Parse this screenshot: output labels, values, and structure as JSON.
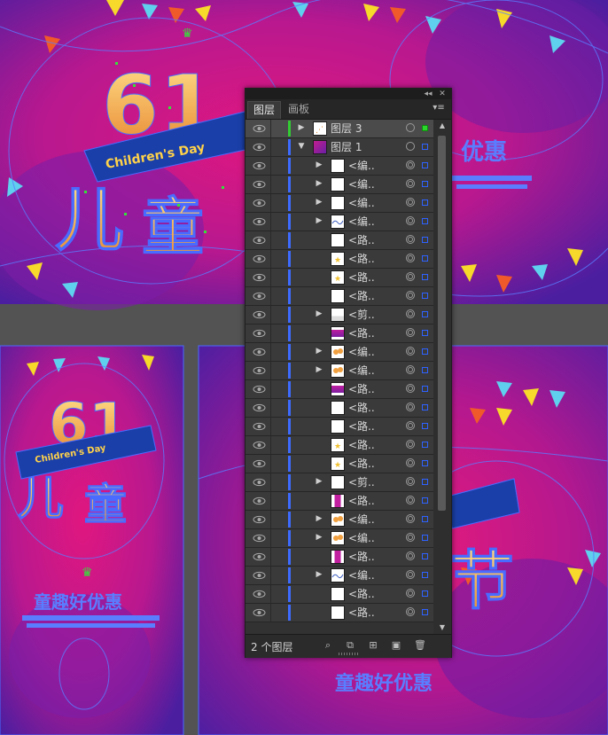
{
  "colors": {
    "canvas_bg": "#535353",
    "artwork_magenta": "#d1158f",
    "artwork_purple": "#5b1fa8",
    "selection_blue": "#4a6bff",
    "path_green": "#35e23a",
    "title_text_orange": "#f2a33a",
    "panel_bg": "#323232",
    "row_bg": "#3a3a3a"
  },
  "artboards": {
    "top_title_text": "6·1 儿童节",
    "ribbon_text": "Children's Day",
    "bottom_left_title_text": "6·1 儿童节",
    "bottom_left_ribbon_text": "Children's Day",
    "promo_text_top_right": "优惠",
    "promo_text_bottom_left": "童趣好优惠",
    "promo_text_bottom_right": "童趣好优惠"
  },
  "panel": {
    "tabs": [
      {
        "label": "图层",
        "active": true
      },
      {
        "label": "画板",
        "active": false
      }
    ],
    "collapse_icon": "double-arrow-left-icon",
    "close_icon": "close-icon",
    "menu_icon": "panel-menu-icon",
    "rows": [
      {
        "name": "图层 3",
        "level": 0,
        "expanded": false,
        "has_arrow": true,
        "thumb": "layer3-thumb",
        "bar_color": "#33cc33",
        "sel": "green",
        "selected": true
      },
      {
        "name": "图层 1",
        "level": 0,
        "expanded": true,
        "has_arrow": true,
        "thumb": "layer1-thumb",
        "bar_color": "#3d6bff",
        "sel": "blue",
        "selected": false
      },
      {
        "name": "<编..",
        "level": 1,
        "has_arrow": true,
        "thumb": "white",
        "sel": "blue"
      },
      {
        "name": "<编..",
        "level": 1,
        "has_arrow": true,
        "thumb": "white",
        "sel": "blue"
      },
      {
        "name": "<编..",
        "level": 1,
        "has_arrow": true,
        "thumb": "white",
        "sel": "blue"
      },
      {
        "name": "<编..",
        "level": 1,
        "has_arrow": true,
        "thumb": "squiggle",
        "sel": "blue"
      },
      {
        "name": "<路..",
        "level": 1,
        "has_arrow": false,
        "thumb": "white",
        "sel": "blue"
      },
      {
        "name": "<路..",
        "level": 1,
        "has_arrow": false,
        "thumb": "star",
        "sel": "blue"
      },
      {
        "name": "<路..",
        "level": 1,
        "has_arrow": false,
        "thumb": "star",
        "sel": "blue"
      },
      {
        "name": "<路..",
        "level": 1,
        "has_arrow": false,
        "thumb": "white",
        "sel": "blue"
      },
      {
        "name": "<剪..",
        "level": 1,
        "has_arrow": true,
        "thumb": "clip",
        "sel": "blue"
      },
      {
        "name": "<路..",
        "level": 1,
        "has_arrow": false,
        "thumb": "magenta",
        "sel": "blue"
      },
      {
        "name": "<编..",
        "level": 1,
        "has_arrow": true,
        "thumb": "orange",
        "sel": "blue"
      },
      {
        "name": "<编..",
        "level": 1,
        "has_arrow": true,
        "thumb": "orange",
        "sel": "blue"
      },
      {
        "name": "<路..",
        "level": 1,
        "has_arrow": false,
        "thumb": "magenta",
        "sel": "blue"
      },
      {
        "name": "<路..",
        "level": 1,
        "has_arrow": false,
        "thumb": "white",
        "sel": "blue"
      },
      {
        "name": "<路..",
        "level": 1,
        "has_arrow": false,
        "thumb": "white",
        "sel": "blue"
      },
      {
        "name": "<路..",
        "level": 1,
        "has_arrow": false,
        "thumb": "star",
        "sel": "blue"
      },
      {
        "name": "<路..",
        "level": 1,
        "has_arrow": false,
        "thumb": "star",
        "sel": "blue"
      },
      {
        "name": "<剪..",
        "level": 1,
        "has_arrow": true,
        "thumb": "white",
        "sel": "blue"
      },
      {
        "name": "<路..",
        "level": 1,
        "has_arrow": false,
        "thumb": "magenta-frame",
        "sel": "blue"
      },
      {
        "name": "<编..",
        "level": 1,
        "has_arrow": true,
        "thumb": "orange",
        "sel": "blue"
      },
      {
        "name": "<编..",
        "level": 1,
        "has_arrow": true,
        "thumb": "orange",
        "sel": "blue"
      },
      {
        "name": "<路..",
        "level": 1,
        "has_arrow": false,
        "thumb": "magenta-frame",
        "sel": "blue"
      },
      {
        "name": "<编..",
        "level": 1,
        "has_arrow": true,
        "thumb": "squiggle",
        "sel": "blue"
      },
      {
        "name": "<路..",
        "level": 1,
        "has_arrow": false,
        "thumb": "white",
        "sel": "blue"
      },
      {
        "name": "<路..",
        "level": 1,
        "has_arrow": false,
        "thumb": "white",
        "sel": "blue"
      }
    ],
    "footer": {
      "count_label": "2 个图层",
      "buttons": [
        "locate-object-icon",
        "make-clipping-mask-icon",
        "create-sublayer-icon",
        "create-new-layer-icon",
        "delete-icon"
      ]
    }
  }
}
